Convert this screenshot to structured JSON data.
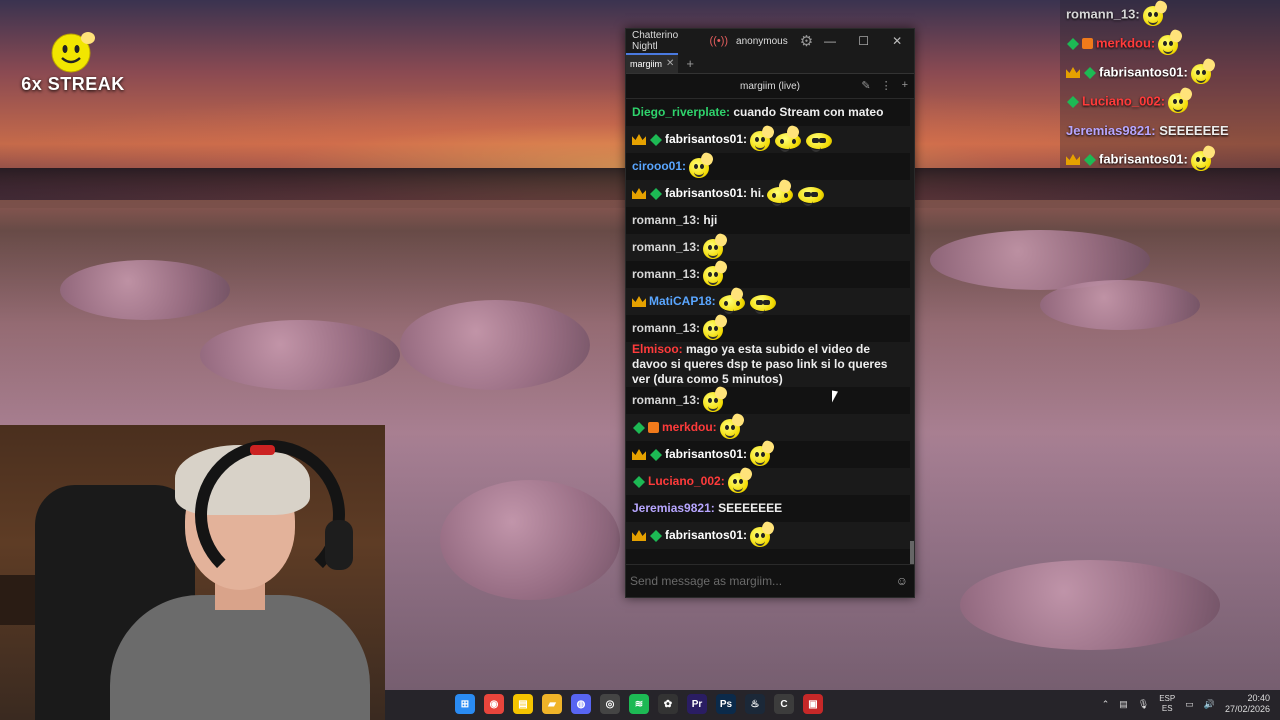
{
  "streak": {
    "label": "6x STREAK"
  },
  "window": {
    "app_title": "Chatterino Nightl",
    "account": "anonymous",
    "tab": "margiim",
    "split_title": "margiim (live)",
    "input_placeholder": "Send message as margiim..."
  },
  "chat": [
    {
      "user": "Diego_riverplate:",
      "color": "#2fd36c",
      "text": "cuando Stream con mateo",
      "badges": [],
      "emotes": []
    },
    {
      "user": "fabrisantos01:",
      "color": "#ffffff",
      "text": "",
      "badges": [
        "crown",
        "gem"
      ],
      "emotes": [
        "ok",
        "hand",
        "glasses"
      ]
    },
    {
      "user": "cirooo01:",
      "color": "#5aa6ff",
      "text": "",
      "badges": [],
      "emotes": [
        "ok"
      ]
    },
    {
      "user": "fabrisantos01:",
      "color": "#ffffff",
      "text": "hi.",
      "badges": [
        "crown",
        "gem"
      ],
      "emotes": [
        "hand",
        "glasses"
      ]
    },
    {
      "user": "romann_13:",
      "color": "#d7d7d7",
      "text": "hji",
      "badges": [],
      "emotes": []
    },
    {
      "user": "romann_13:",
      "color": "#d7d7d7",
      "text": "",
      "badges": [],
      "emotes": [
        "ok"
      ]
    },
    {
      "user": "romann_13:",
      "color": "#d7d7d7",
      "text": "",
      "badges": [],
      "emotes": [
        "ok"
      ]
    },
    {
      "user": "MatiCAP18:",
      "color": "#5aa6ff",
      "text": "",
      "badges": [
        "crown"
      ],
      "emotes": [
        "hand",
        "glasses"
      ]
    },
    {
      "user": "romann_13:",
      "color": "#d7d7d7",
      "text": "",
      "badges": [],
      "emotes": [
        "ok"
      ]
    },
    {
      "user": "Elmisoo:",
      "color": "#ff3b3b",
      "text": "mago ya esta subido el video de davoo si queres dsp te paso link si lo queres ver (dura como 5 minutos)",
      "badges": [],
      "emotes": []
    },
    {
      "user": "romann_13:",
      "color": "#d7d7d7",
      "text": "",
      "badges": [],
      "emotes": [
        "ok"
      ]
    },
    {
      "user": "merkdou:",
      "color": "#ff3b3b",
      "text": "",
      "badges": [
        "gem",
        "gift"
      ],
      "emotes": [
        "ok"
      ]
    },
    {
      "user": "fabrisantos01:",
      "color": "#ffffff",
      "text": "",
      "badges": [
        "crown",
        "gem"
      ],
      "emotes": [
        "ok"
      ]
    },
    {
      "user": "Luciano_002:",
      "color": "#ff3b3b",
      "text": "",
      "badges": [
        "gem"
      ],
      "emotes": [
        "ok"
      ]
    },
    {
      "user": "Jeremias9821:",
      "color": "#b7a6ff",
      "text": "SEEEEEEE",
      "badges": [],
      "emotes": []
    },
    {
      "user": "fabrisantos01:",
      "color": "#ffffff",
      "text": "",
      "badges": [
        "crown",
        "gem"
      ],
      "emotes": [
        "ok"
      ]
    }
  ],
  "overlay": [
    {
      "user": "romann_13:",
      "color": "#d7d7d7",
      "text": "",
      "badges": [],
      "emotes": [
        "ok"
      ]
    },
    {
      "user": "merkdou:",
      "color": "#ff3b3b",
      "text": "",
      "badges": [
        "gem",
        "gift"
      ],
      "emotes": [
        "ok"
      ]
    },
    {
      "user": "fabrisantos01:",
      "color": "#ffffff",
      "text": "",
      "badges": [
        "crown",
        "gem"
      ],
      "emotes": [
        "ok"
      ]
    },
    {
      "user": "Luciano_002:",
      "color": "#ff3b3b",
      "text": "",
      "badges": [
        "gem"
      ],
      "emotes": [
        "ok"
      ]
    },
    {
      "user": "Jeremias9821:",
      "color": "#b7a6ff",
      "text": "SEEEEEEE",
      "badges": [],
      "emotes": []
    },
    {
      "user": "fabrisantos01:",
      "color": "#ffffff",
      "text": "",
      "badges": [
        "crown",
        "gem"
      ],
      "emotes": [
        "ok"
      ]
    }
  ],
  "taskbar": {
    "apps": [
      {
        "name": "start-icon",
        "color": "#2a8bf2",
        "glyph": "⊞"
      },
      {
        "name": "chrome-icon",
        "color": "#e8453c",
        "glyph": "◉"
      },
      {
        "name": "notes-icon",
        "color": "#f5c400",
        "glyph": "▤"
      },
      {
        "name": "explorer-icon",
        "color": "#f0b429",
        "glyph": "▰"
      },
      {
        "name": "discord-icon",
        "color": "#5865f2",
        "glyph": "◍"
      },
      {
        "name": "obs-icon",
        "color": "#444444",
        "glyph": "◎"
      },
      {
        "name": "spotify-icon",
        "color": "#1db954",
        "glyph": "≋"
      },
      {
        "name": "chatgpt-icon",
        "color": "#333333",
        "glyph": "✿"
      },
      {
        "name": "premiere-icon",
        "color": "#2a1d63",
        "glyph": "Pr"
      },
      {
        "name": "photoshop-icon",
        "color": "#0b2a4a",
        "glyph": "Ps"
      },
      {
        "name": "steam-icon",
        "color": "#1b2838",
        "glyph": "♨"
      },
      {
        "name": "chatterino-icon",
        "color": "#3c3c3c",
        "glyph": "C"
      },
      {
        "name": "voicemod-icon",
        "color": "#c62828",
        "glyph": "▣"
      }
    ],
    "lang_top": "ESP",
    "lang_bottom": "ES",
    "time": "20:40",
    "date": "27/02/2026"
  }
}
